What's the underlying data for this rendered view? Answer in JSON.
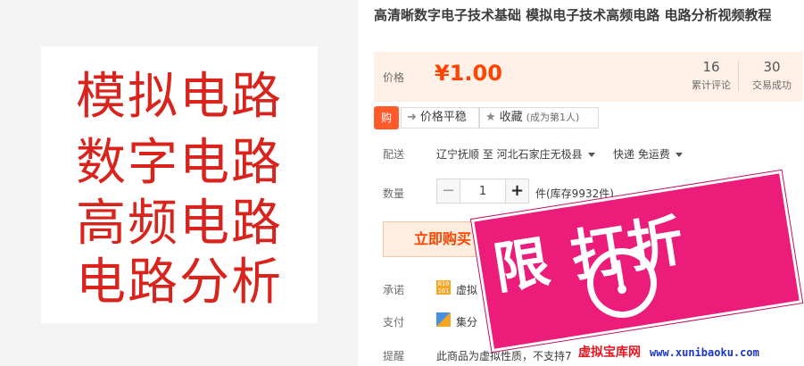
{
  "gallery": {
    "image_lines": [
      "模拟电路",
      "数字电路",
      "高频电路",
      "电路分析"
    ]
  },
  "product": {
    "title": "高清晰数字电子技术基础 模拟电子技术高频电路 电路分析视频教程"
  },
  "price": {
    "label": "价格",
    "value": "¥1.00",
    "reviews_count": "16",
    "reviews_label": "累计评论",
    "trades_count": "30",
    "trades_label": "交易成功"
  },
  "actions": {
    "taobao_icon": "购",
    "trend_label": "价格平稳",
    "favorite_label": "收藏",
    "favorite_note": "(成为第1人)"
  },
  "shipping": {
    "label": "配送",
    "from_to": "辽宁抚顺 至  河北石家庄无极县",
    "method": "快递 免运费"
  },
  "quantity": {
    "label": "数量",
    "minus": "−",
    "value": "1",
    "plus": "+",
    "stock": "件(库存9932件)"
  },
  "buy": {
    "label": "立即购买"
  },
  "promise": {
    "label": "承诺",
    "icon_text": "010 101",
    "text": "虚拟"
  },
  "payment": {
    "label": "支付",
    "text": "集分"
  },
  "reminder": {
    "label": "提醒",
    "text": "此商品为虚拟性质，不支持7"
  },
  "promo": {
    "text": "限  打折",
    "watermark": "虚拟宝库网",
    "url": "www.xunibaoku.com"
  },
  "colors": {
    "price": "#ff4400",
    "promo_pink": "#ec1c7a",
    "image_text_red": "#d8241c"
  }
}
